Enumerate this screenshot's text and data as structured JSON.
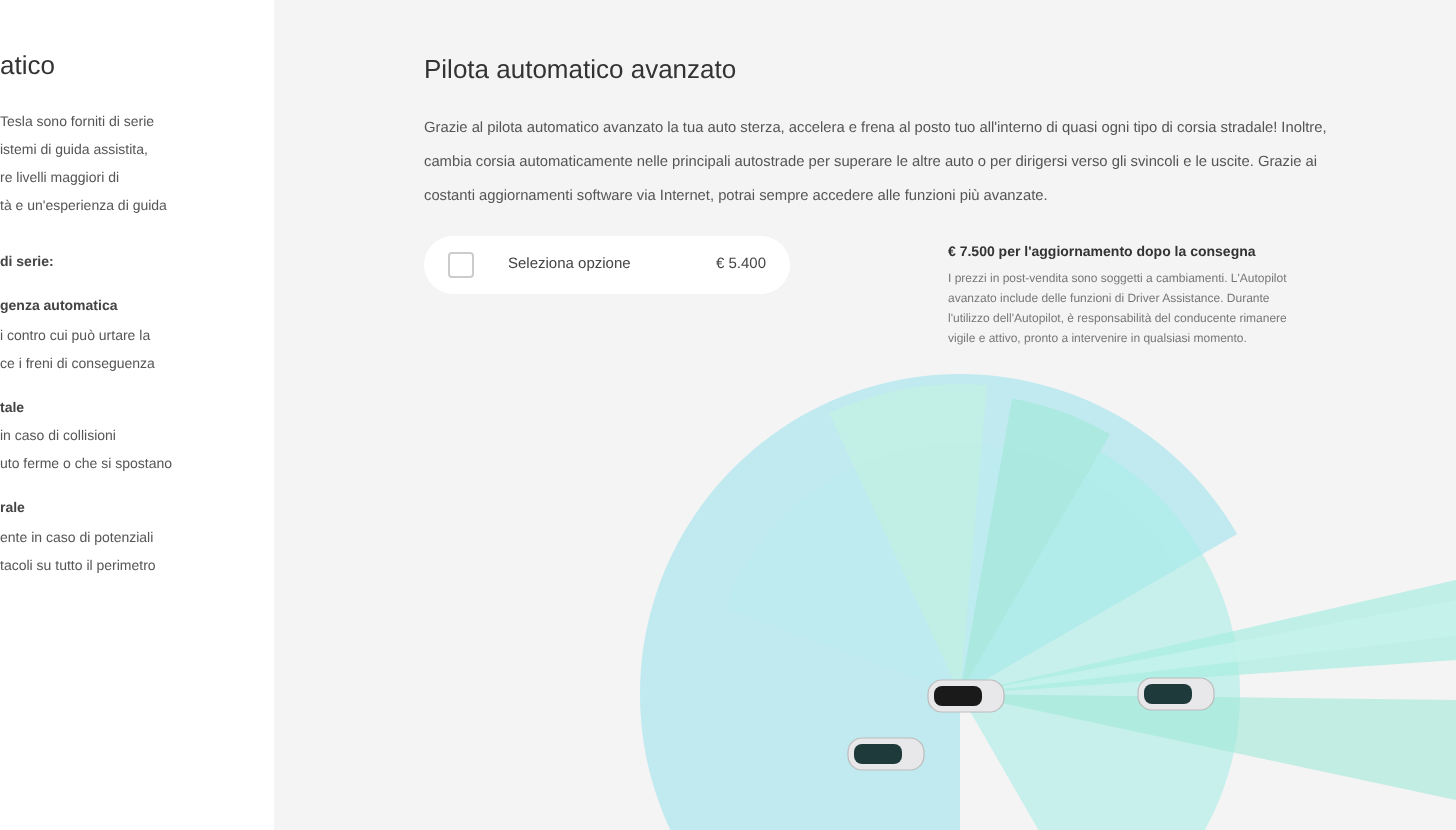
{
  "left_panel": {
    "title": "atico",
    "intro": [
      "Tesla sono forniti di serie",
      "istemi di guida assistita,",
      "re livelli maggiori di",
      "tà e un'esperienza di guida"
    ],
    "list_heading": "di serie:",
    "features": [
      {
        "title": "genza automatica",
        "lines": [
          "i contro cui può urtare la",
          "ce i freni di conseguenza"
        ]
      },
      {
        "title": "tale",
        "lines": [
          "in caso di collisioni",
          "uto ferme o che si spostano"
        ]
      },
      {
        "title": "rale",
        "lines": [
          "ente in caso di potenziali",
          "tacoli su tutto il perimetro"
        ]
      }
    ]
  },
  "main": {
    "title": "Pilota automatico avanzato",
    "description": "Grazie al pilota automatico avanzato la tua auto sterza, accelera e frena al posto tuo all'interno di quasi ogni tipo di corsia stradale! Inoltre, cambia corsia automaticamente nelle principali autostrade per superare le altre auto o per dirigersi verso gli svincoli e le uscite. Grazie ai costanti aggiornamenti software via Internet, potrai sempre accedere alle funzioni più avanzate.",
    "option": {
      "label": "Seleziona opzione",
      "price": "€ 5.400",
      "checked": false
    },
    "upgrade": {
      "title": "€ 7.500 per l'aggiornamento dopo la consegna",
      "note": "I prezzi in post-vendita sono soggetti a cambiamenti. L'Autopilot avanzato include delle funzioni di Driver Assistance. Durante l'utilizzo dell'Autopilot, è responsabilità del conducente rimanere vigile e attivo, pronto a intervenire in qualsiasi momento."
    }
  }
}
